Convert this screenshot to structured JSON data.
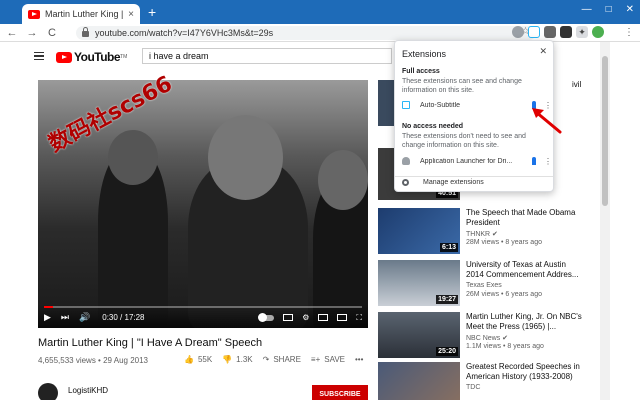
{
  "browser": {
    "tab_title": "Martin Luther King | \"I Have A",
    "tab_close": "×",
    "new_tab": "+",
    "win_min": "—",
    "win_max": "□",
    "win_close": "✕",
    "url": "youtube.com/watch?v=I47Y6VHc3Ms&t=29s",
    "back": "←",
    "forward": "→",
    "reload": "C",
    "star": "☆",
    "menu": "⋮"
  },
  "youtube": {
    "logo_text": "YouTube",
    "logo_sup": "TM",
    "search_value": "i have a dream"
  },
  "player": {
    "watermark": "数码社scs66",
    "time": "0:30 / 17:28",
    "progress_fraction": 0.029
  },
  "video": {
    "title": "Martin Luther King | \"I Have A Dream\" Speech",
    "meta": "4,655,533 views • 29 Aug 2013",
    "likes": "55K",
    "dislikes": "1.3K",
    "share": "SHARE",
    "save": "SAVE",
    "more": "•••",
    "channel": "LogistiKHD",
    "subscribe": "SUBSCRIBE"
  },
  "sidebar": {
    "items": [
      {
        "title": "",
        "channel": "",
        "meta": "",
        "duration": ""
      },
      {
        "title": "",
        "channel": "",
        "meta": "",
        "duration": "40:51"
      },
      {
        "title": "The Speech that Made Obama President",
        "channel": "THNKR ✔",
        "meta": "28M views • 8 years ago",
        "duration": "6:13"
      },
      {
        "title": "University of Texas at Austin 2014 Commencement Addres...",
        "channel": "Texas Exes",
        "meta": "26M views • 6 years ago",
        "duration": "19:27"
      },
      {
        "title": "Martin Luther King, Jr. On NBC's Meet the Press (1965) |...",
        "channel": "NBC News ✔",
        "meta": "1.1M views • 8 years ago",
        "duration": "25:20"
      },
      {
        "title": "Greatest Recorded Speeches in American History (1933-2008)",
        "channel": "TDC",
        "meta": "",
        "duration": ""
      }
    ],
    "partial_top_text": "ivil"
  },
  "extensions_popup": {
    "title": "Extensions",
    "close": "✕",
    "full_access_title": "Full access",
    "full_access_desc": "These extensions can see and change information on this site.",
    "full_ext_name": "Auto-Subtitle",
    "no_access_title": "No access needed",
    "no_access_desc": "These extensions don't need to see and change information on this site.",
    "no_ext_name": "Application Launcher for Dri...",
    "manage": "Manage extensions",
    "more": "⋮"
  },
  "colors": {
    "tabstrip": "#1e6bb8",
    "yt_red": "#ff0000",
    "pin_blue": "#1a73e8",
    "annotation_red": "#e00000"
  }
}
